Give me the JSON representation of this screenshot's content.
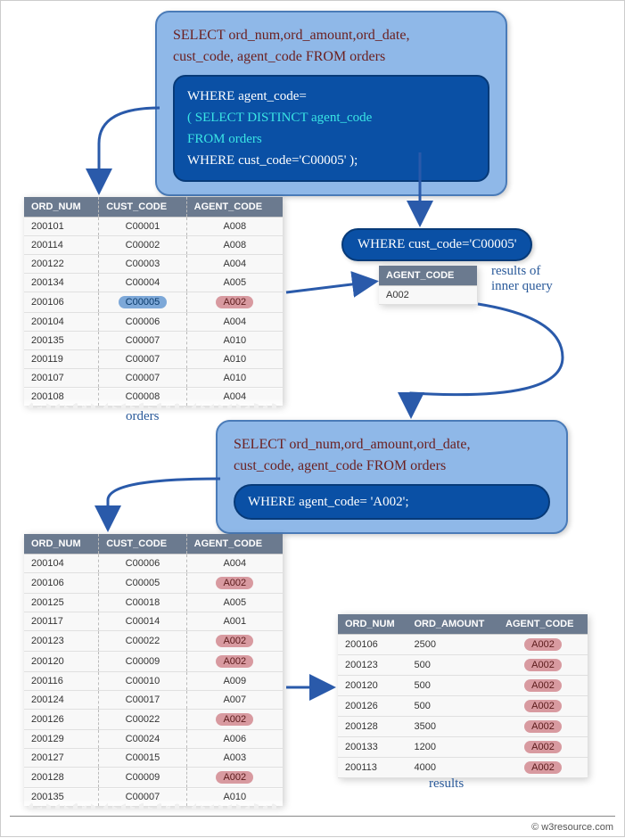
{
  "sql_main": {
    "outer_line1": "SELECT ord_num,ord_amount,ord_date,",
    "outer_line2": "cust_code, agent_code FROM orders",
    "where_clause": "WHERE agent_code=",
    "sub_line1": "( SELECT DISTINCT agent_code",
    "sub_line2": "FROM orders",
    "sub_line3": "WHERE cust_code='C00005' );"
  },
  "pill_where": "WHERE cust_code='C00005'",
  "inner_result_label": "results of\ninner query",
  "orders_label": "orders",
  "results_label": "results",
  "sql_resolved": {
    "outer_line1": "SELECT ord_num,ord_amount,ord_date,",
    "outer_line2": "cust_code, agent_code FROM orders",
    "where_resolved": "WHERE agent_code= 'A002';"
  },
  "table_orders1": {
    "headers": [
      "ORD_NUM",
      "CUST_CODE",
      "AGENT_CODE"
    ],
    "rows": [
      [
        "200101",
        "C00001",
        "A008"
      ],
      [
        "200114",
        "C00002",
        "A008"
      ],
      [
        "200122",
        "C00003",
        "A004"
      ],
      [
        "200134",
        "C00004",
        "A005"
      ],
      [
        "200106",
        "C00005",
        "A002"
      ],
      [
        "200104",
        "C00006",
        "A004"
      ],
      [
        "200135",
        "C00007",
        "A010"
      ],
      [
        "200119",
        "C00007",
        "A010"
      ],
      [
        "200107",
        "C00007",
        "A010"
      ],
      [
        "200108",
        "C00008",
        "A004"
      ]
    ]
  },
  "table_inner": {
    "header": "AGENT_CODE",
    "value": "A002"
  },
  "table_orders2": {
    "headers": [
      "ORD_NUM",
      "CUST_CODE",
      "AGENT_CODE"
    ],
    "rows": [
      [
        "200104",
        "C00006",
        "A004"
      ],
      [
        "200106",
        "C00005",
        "A002"
      ],
      [
        "200125",
        "C00018",
        "A005"
      ],
      [
        "200117",
        "C00014",
        "A001"
      ],
      [
        "200123",
        "C00022",
        "A002"
      ],
      [
        "200120",
        "C00009",
        "A002"
      ],
      [
        "200116",
        "C00010",
        "A009"
      ],
      [
        "200124",
        "C00017",
        "A007"
      ],
      [
        "200126",
        "C00022",
        "A002"
      ],
      [
        "200129",
        "C00024",
        "A006"
      ],
      [
        "200127",
        "C00015",
        "A003"
      ],
      [
        "200128",
        "C00009",
        "A002"
      ],
      [
        "200135",
        "C00007",
        "A010"
      ]
    ]
  },
  "table_results": {
    "headers": [
      "ORD_NUM",
      "ORD_AMOUNT",
      "AGENT_CODE"
    ],
    "rows": [
      [
        "200106",
        "2500",
        "A002"
      ],
      [
        "200123",
        "500",
        "A002"
      ],
      [
        "200120",
        "500",
        "A002"
      ],
      [
        "200126",
        "500",
        "A002"
      ],
      [
        "200128",
        "3500",
        "A002"
      ],
      [
        "200133",
        "1200",
        "A002"
      ],
      [
        "200113",
        "4000",
        "A002"
      ]
    ]
  },
  "footer": "© w3resource.com"
}
